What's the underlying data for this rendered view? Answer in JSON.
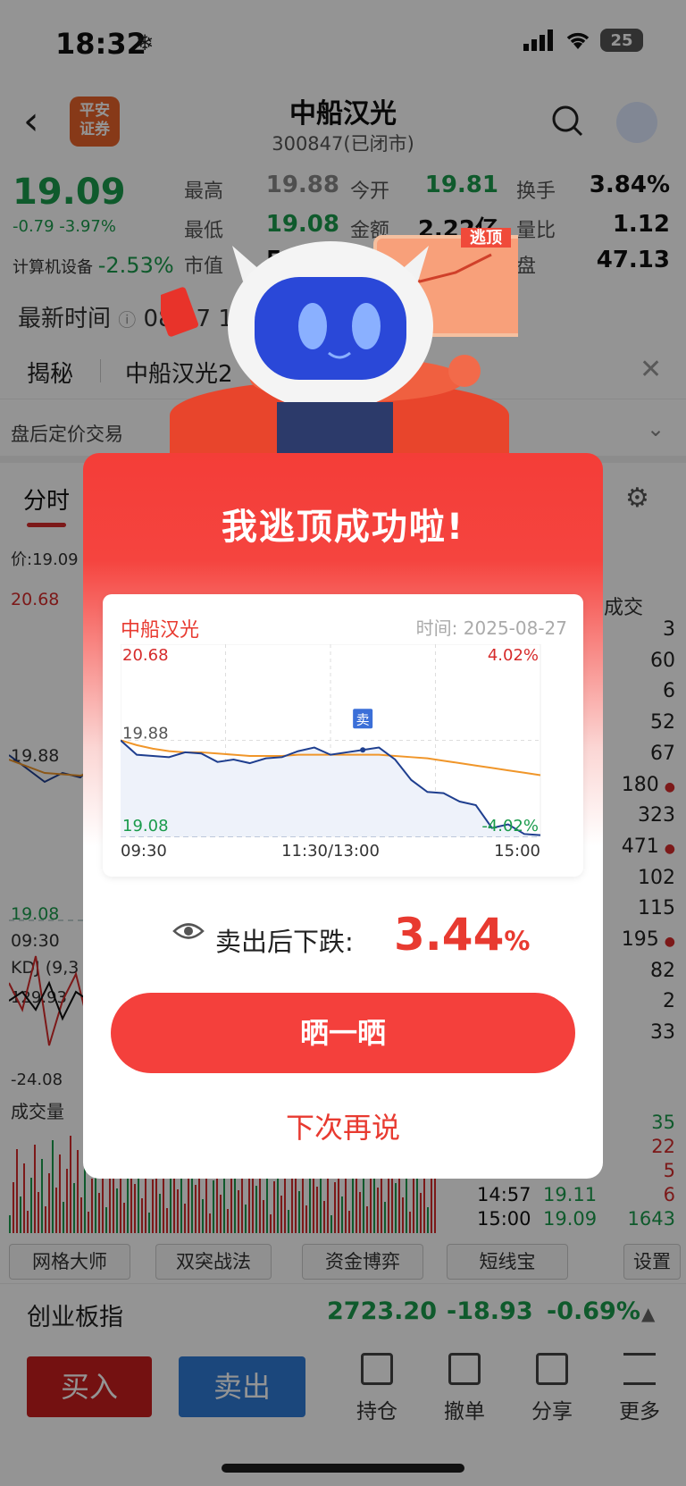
{
  "status_bar": {
    "time": "18:32",
    "battery": "25"
  },
  "header": {
    "logo_text": "平安\n证券",
    "title": "中船汉光",
    "subtitle": "300847(已闭市)"
  },
  "quote": {
    "price": "19.09",
    "change": "-0.79 -3.97%",
    "sector_label": "计算机设备",
    "sector_change": "-2.53%",
    "rows": [
      [
        {
          "label": "最高",
          "value": "19.88",
          "color": "gray"
        },
        {
          "label": "今开",
          "value": "19.81",
          "color": "green"
        },
        {
          "label": "换手",
          "value": "3.84%",
          "color": "dark"
        }
      ],
      [
        {
          "label": "最低",
          "value": "19.08",
          "color": "green"
        },
        {
          "label": "金额",
          "value": "2.22亿",
          "color": "dark"
        },
        {
          "label": "量比",
          "value": "1.12",
          "color": "dark"
        }
      ],
      [
        {
          "label": "市值",
          "value": "56.51亿",
          "color": "dark"
        },
        {
          "label": "流通",
          "value": "",
          "color": "dark"
        },
        {
          "label": "盘",
          "value": "47.13",
          "color": "dark"
        }
      ]
    ],
    "update_time_label": "最新时间",
    "update_time_value": "08-27 18:"
  },
  "reveal": {
    "tab": "揭秘",
    "text": "中船汉光2       揭秘"
  },
  "after_hours": "盘后定价交易",
  "chart_tabs": {
    "active": "分时"
  },
  "main_chart": {
    "price_label": "价:19.09",
    "y_high": "20.68",
    "y_mid": "19.88",
    "y_low": "19.08",
    "x_start": "09:30",
    "kdj_label": "KDJ (9,3",
    "kdj_high": "129.93",
    "kdj_low": "-24.08",
    "volume_label": "成交量"
  },
  "side_panel": {
    "header": "成交",
    "volumes": [
      "3",
      "60",
      "6",
      "52",
      "67",
      "180",
      "323",
      "471",
      "102",
      "115",
      "195",
      "82",
      "2",
      "33"
    ],
    "dots": [
      false,
      false,
      false,
      false,
      false,
      true,
      false,
      true,
      false,
      false,
      true,
      false,
      false,
      false
    ],
    "ticks": [
      {
        "time": "",
        "price": "",
        "vol": "35",
        "color": "#1a9b4c"
      },
      {
        "time": "",
        "price": "",
        "vol": "22",
        "color": "#d62b2b"
      },
      {
        "time": "",
        "price": "",
        "vol": "5",
        "color": "#d62b2b"
      },
      {
        "time": "14:57",
        "price": "19.11",
        "vol": "6",
        "color": "#d62b2b"
      },
      {
        "time": "15:00",
        "price": "19.09",
        "vol": "1643",
        "color": "#1a9b4c"
      }
    ]
  },
  "tools": [
    "网格大师",
    "双突战法",
    "资金博弈",
    "短线宝",
    "设置"
  ],
  "index": {
    "name": "创业板指",
    "value": "2723.20",
    "change": "-18.93",
    "pct": "-0.69%"
  },
  "bottom_nav": {
    "buy": "买入",
    "sell": "卖出",
    "items": [
      "持仓",
      "撤单",
      "分享",
      "更多"
    ]
  },
  "modal": {
    "title": "我逃顶成功啦!",
    "mascot_tag": "逃顶",
    "card_name": "中船汉光",
    "card_date_label": "时间:",
    "card_date": "2025-08-27",
    "drop_label": "卖出后下跌:",
    "drop_value": "3.44",
    "drop_unit": "%",
    "share_button": "晒一晒",
    "later_link": "下次再说"
  },
  "chart_data": {
    "type": "line",
    "title": "中船汉光",
    "x_ticks": [
      "09:30",
      "11:30/13:00",
      "15:00"
    ],
    "ylim": [
      19.08,
      20.68
    ],
    "y_ticks": [
      "20.68",
      "19.88",
      "19.08"
    ],
    "pct_ticks": [
      "4.02%",
      "-4.02%"
    ],
    "sell_marker": "卖",
    "series": [
      {
        "name": "",
        "color": "#1f3f8f",
        "values": [
          19.88,
          19.76,
          19.75,
          19.74,
          19.78,
          19.77,
          19.7,
          19.72,
          19.69,
          19.73,
          19.74,
          19.79,
          19.82,
          19.76,
          19.78,
          19.8,
          19.82,
          19.72,
          19.55,
          19.45,
          19.44,
          19.37,
          19.34,
          19.15,
          19.18,
          19.1,
          19.09
        ]
      },
      {
        "name": "",
        "color": "#f0962a",
        "values": [
          19.88,
          19.84,
          19.81,
          19.79,
          19.78,
          19.78,
          19.77,
          19.76,
          19.75,
          19.75,
          19.75,
          19.76,
          19.76,
          19.76,
          19.76,
          19.76,
          19.76,
          19.75,
          19.74,
          19.73,
          19.71,
          19.69,
          19.67,
          19.65,
          19.63,
          19.61,
          19.59
        ]
      }
    ]
  }
}
